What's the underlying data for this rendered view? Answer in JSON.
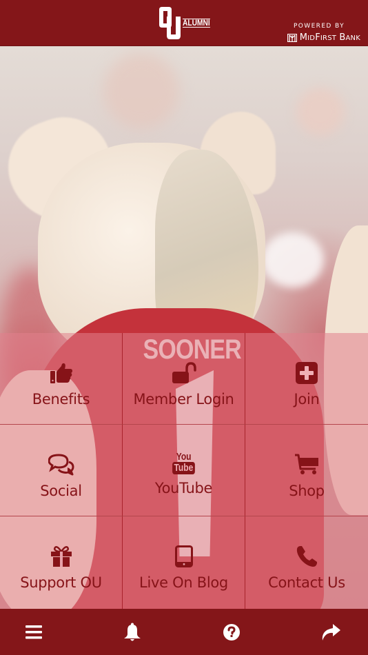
{
  "header": {
    "logo_mark": "OU",
    "logo_text": "ALUMNI",
    "powered_by": "POWERED BY",
    "sponsor_prefix": "M",
    "sponsor_small1": "ID",
    "sponsor_mid": "F",
    "sponsor_small2": "IRST",
    "sponsor_b": "B",
    "sponsor_small3": "ANK",
    "sponsor_icon": "midfirst-logo-icon"
  },
  "hero": {
    "image": "Sooner mascot in white fur costume wearing crimson SOONER #1 jersey"
  },
  "grid": {
    "tiles": [
      {
        "label": "Benefits",
        "icon": "thumbs-up-icon"
      },
      {
        "label": "Member Login",
        "icon": "unlock-icon"
      },
      {
        "label": "Join",
        "icon": "plus-square-icon"
      },
      {
        "label": "Social",
        "icon": "chat-bubbles-icon"
      },
      {
        "label": "YouTube",
        "icon": "youtube-icon"
      },
      {
        "label": "Shop",
        "icon": "shopping-cart-icon"
      },
      {
        "label": "Support OU",
        "icon": "gift-icon"
      },
      {
        "label": "Live On Blog",
        "icon": "tablet-icon"
      },
      {
        "label": "Contact Us",
        "icon": "phone-icon"
      }
    ],
    "youtube_you": "You",
    "youtube_tube": "Tube"
  },
  "bottom_bar": {
    "items": [
      {
        "icon": "menu-icon"
      },
      {
        "icon": "bell-icon"
      },
      {
        "icon": "help-icon"
      },
      {
        "icon": "share-icon"
      }
    ]
  },
  "colors": {
    "brand_crimson": "#841619",
    "tile_overlay": "#e2808c",
    "label_text": "#861318"
  }
}
